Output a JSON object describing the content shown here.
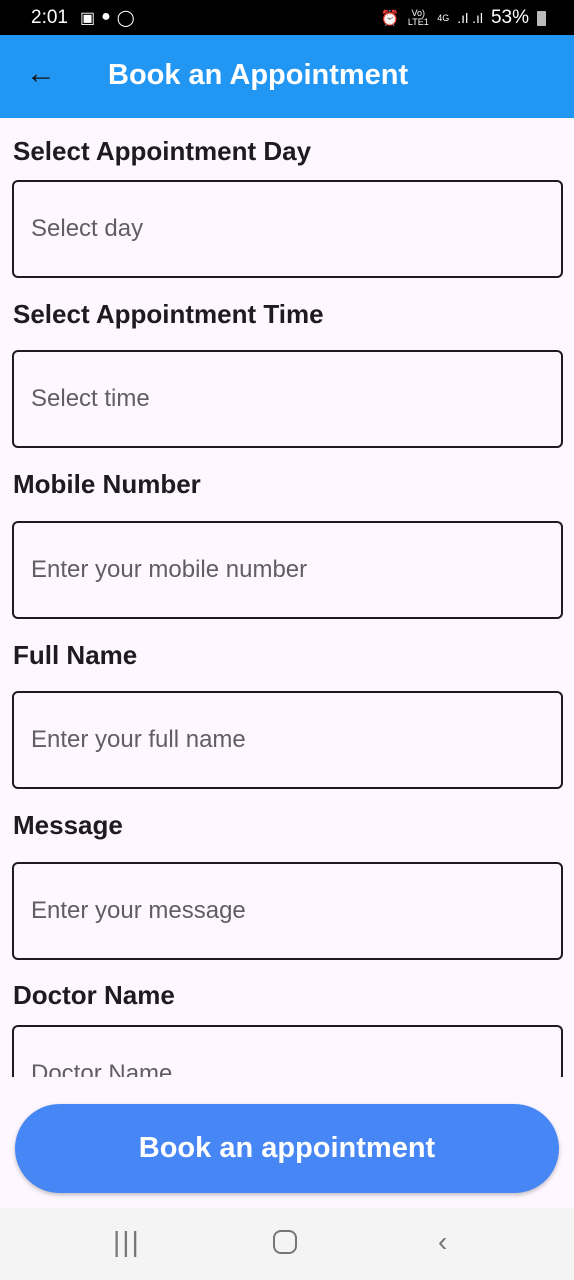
{
  "status_bar": {
    "time": "2:01",
    "battery": "53%",
    "network": "4G",
    "carrier": "Vo) LTE1",
    "left_icons": [
      "gallery-icon",
      "chat-icon",
      "whatsapp-icon"
    ]
  },
  "app_bar": {
    "title": "Book an Appointment",
    "back_icon": "arrow-left-icon"
  },
  "form": {
    "fields": [
      {
        "label": "Select Appointment Day",
        "placeholder": "Select day"
      },
      {
        "label": "Select Appointment Time",
        "placeholder": "Select time"
      },
      {
        "label": "Mobile Number",
        "placeholder": "Enter your mobile number"
      },
      {
        "label": "Full Name",
        "placeholder": "Enter your full name"
      },
      {
        "label": "Message",
        "placeholder": "Enter your message"
      },
      {
        "label": "Doctor Name",
        "placeholder": "Doctor Name"
      }
    ]
  },
  "submit_button": {
    "label": "Book an appointment",
    "color": "#4687f5"
  },
  "colors": {
    "app_bar": "#2196f3",
    "background": "#fef7ff"
  }
}
